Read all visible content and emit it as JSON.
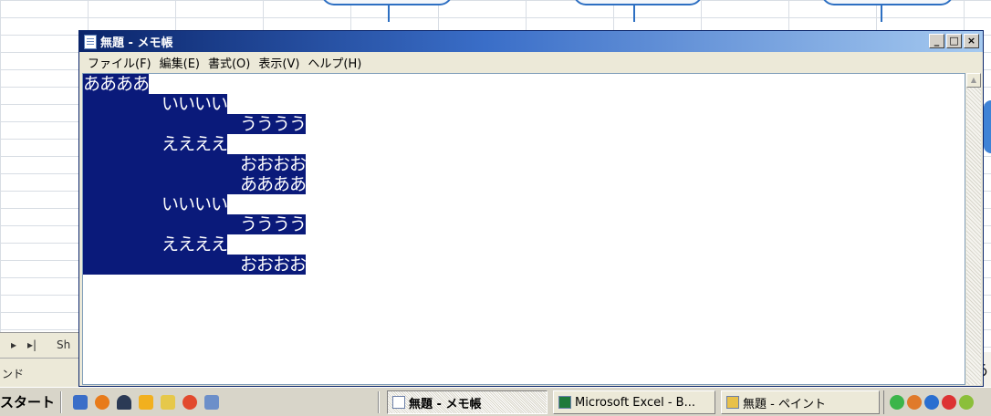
{
  "window": {
    "title": "無題 - メモ帳",
    "buttons": {
      "minimize": "_",
      "maximize": "□",
      "close": "×"
    }
  },
  "menu": [
    "ファイル(F)",
    "編集(E)",
    "書式(O)",
    "表示(V)",
    "ヘルプ(H)"
  ],
  "editor": {
    "lines": [
      {
        "text": "ああああ",
        "indent": 0
      },
      {
        "text": "いいいい",
        "indent": 1
      },
      {
        "text": "うううう",
        "indent": 2
      },
      {
        "text": "ええええ",
        "indent": 1
      },
      {
        "text": "おおおお",
        "indent": 2
      },
      {
        "text": "ああああ",
        "indent": 2
      },
      {
        "text": "いいいい",
        "indent": 1
      },
      {
        "text": "うううう",
        "indent": 2
      },
      {
        "text": "ええええ",
        "indent": 1
      },
      {
        "text": "おおおお",
        "indent": 2
      }
    ]
  },
  "background": {
    "sheet_tab": "Sh",
    "command_text": "ンド",
    "ime_char": "あ"
  },
  "taskbar": {
    "start": "スタート",
    "tasks": [
      {
        "label": "無題 - メモ帳",
        "active": true
      },
      {
        "label": "Microsoft Excel - B...",
        "active": false
      },
      {
        "label": "無題 - ペイント",
        "active": false
      }
    ]
  },
  "colors": {
    "selection": "#0a1a7a",
    "title_start": "#0a246a",
    "title_end": "#a6caf0"
  }
}
